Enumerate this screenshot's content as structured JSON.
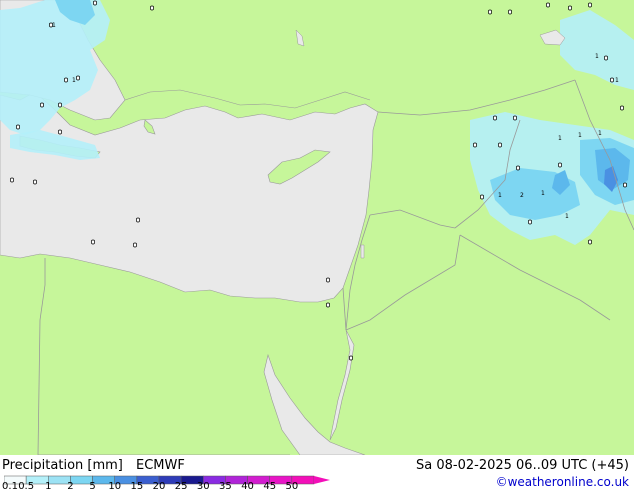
{
  "footer": {
    "title": "Precipitation [mm]",
    "model": "ECMWF",
    "valid_time": "Sa 08-02-2025 06..09 UTC (+45)",
    "credit": "©weatheronline.co.uk"
  },
  "legend": {
    "ticks": [
      "0.1",
      "0.5",
      "1",
      "2",
      "5",
      "10",
      "15",
      "20",
      "25",
      "30",
      "35",
      "40",
      "45",
      "50"
    ],
    "colors": [
      "#f4fbfc",
      "#b4f0f9",
      "#9ce2f4",
      "#7dd6f2",
      "#5cb8ec",
      "#4a90e2",
      "#3b5fcf",
      "#2e3cb8",
      "#1a1a8f",
      "#8a2be2",
      "#b024d8",
      "#d21dcf",
      "#e815c6",
      "#f30fb9"
    ]
  },
  "colors": {
    "land": "#c6f69a",
    "sea": "#e9e9e9",
    "light_precip": "#b4f0f9",
    "medium_precip": "#7dd6f2",
    "heavy_precip": "#5cb8ec",
    "border": "#999999"
  },
  "map": {
    "station_values": [
      "1",
      "2",
      "1",
      "1",
      "1",
      "1",
      "1",
      "1",
      "1",
      "1",
      "1"
    ]
  }
}
